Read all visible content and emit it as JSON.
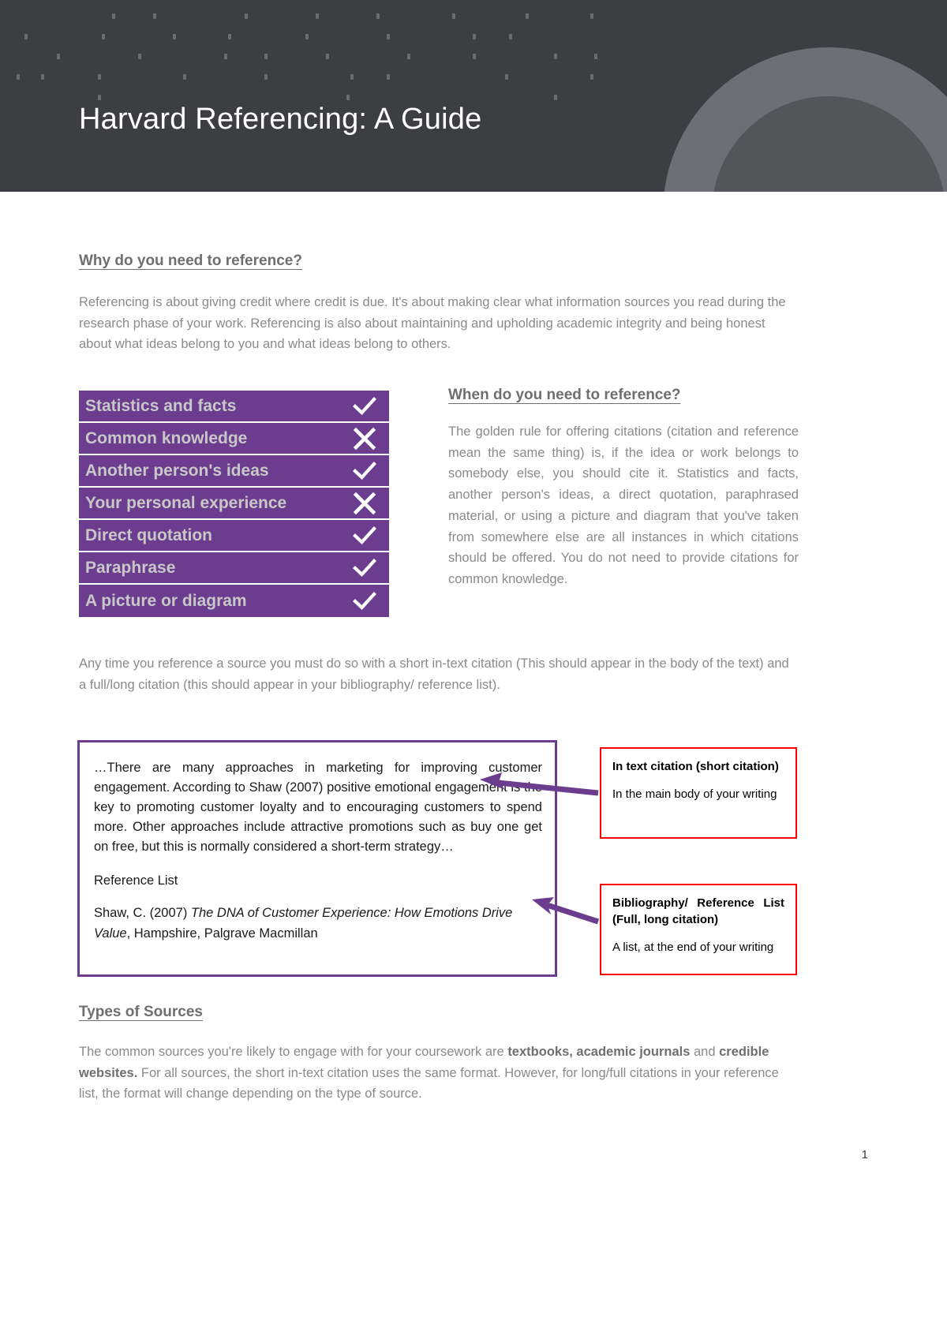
{
  "header": {
    "title": "Harvard Referencing: A Guide",
    "background_color": "#3d3e42",
    "title_color": "#ffffff"
  },
  "sections": {
    "why": {
      "heading": "Why do you need to reference?",
      "paragraph": "Referencing is about giving credit where credit is due. It's about making clear what information sources you read during the research phase of your work. Referencing is also about maintaining and upholding academic integrity and being honest about what ideas belong to you and what ideas belong to others."
    },
    "when": {
      "heading": "When do you need to reference?",
      "paragraph": "The golden rule for offering citations (citation and reference mean the same thing) is, if the idea or work belongs to somebody else, you should cite it. Statistics and facts, another person's ideas, a direct quotation, paraphrased material, or using a picture and diagram that you've taken from somewhere else are all instances in which citations should be offered. You do not need to provide citations for common knowledge."
    },
    "anytime": {
      "paragraph": "Any time you reference a source you must do so with a short in-text citation (This should appear in the body of the text) and a full/long citation (this should appear in your bibliography/ reference list)."
    },
    "types": {
      "heading": "Types of Sources",
      "paragraph_part1": "The common sources you're likely to engage with for your coursework are ",
      "paragraph_bold1": "textbooks, academic journals",
      "paragraph_part2": " and ",
      "paragraph_bold2": "credible websites.",
      "paragraph_part3": " For all sources, the short in-text citation uses the same format. However, for long/full citations in your reference list, the format will change depending on the type of source."
    }
  },
  "checklist": {
    "accent_color": "#6c3d8f",
    "label_color": "#c8c8c8",
    "rows": [
      {
        "label": "Statistics and facts",
        "mark": "check-icon"
      },
      {
        "label": "Common knowledge",
        "mark": "cross-icon"
      },
      {
        "label": "Another person's ideas",
        "mark": "check-icon"
      },
      {
        "label": "Your personal experience",
        "mark": "cross-icon"
      },
      {
        "label": "Direct quotation",
        "mark": "check-icon"
      },
      {
        "label": "Paraphrase",
        "mark": "check-icon"
      },
      {
        "label": "A picture or diagram",
        "mark": "check-icon"
      }
    ]
  },
  "example_box": {
    "border_color": "#6c3d8f",
    "excerpt": "…There are many approaches in marketing for improving customer engagement. According to Shaw (2007) positive emotional engagement is the key to promoting customer loyalty and to encouraging customers to spend more. Other approaches include attractive promotions such as buy one get on free, but this is normally considered a short-term strategy…",
    "reference_list_label": "Reference List",
    "reference_entry_prefix": "Shaw, C. (2007) ",
    "reference_entry_italic": "The DNA of Customer Experience: How Emotions Drive Value",
    "reference_entry_suffix": ", Hampshire, Palgrave Macmillan"
  },
  "callouts": {
    "border_color": "#ff0000",
    "arrow_color": "#6c3d8f",
    "items": [
      {
        "title": "In text citation (short citation)",
        "body": "In the main body of your writing"
      },
      {
        "title": "Bibliography/ Reference List (Full, long citation)",
        "body": "A list, at the end of your writing"
      }
    ]
  },
  "footer": {
    "page_number": "1"
  }
}
